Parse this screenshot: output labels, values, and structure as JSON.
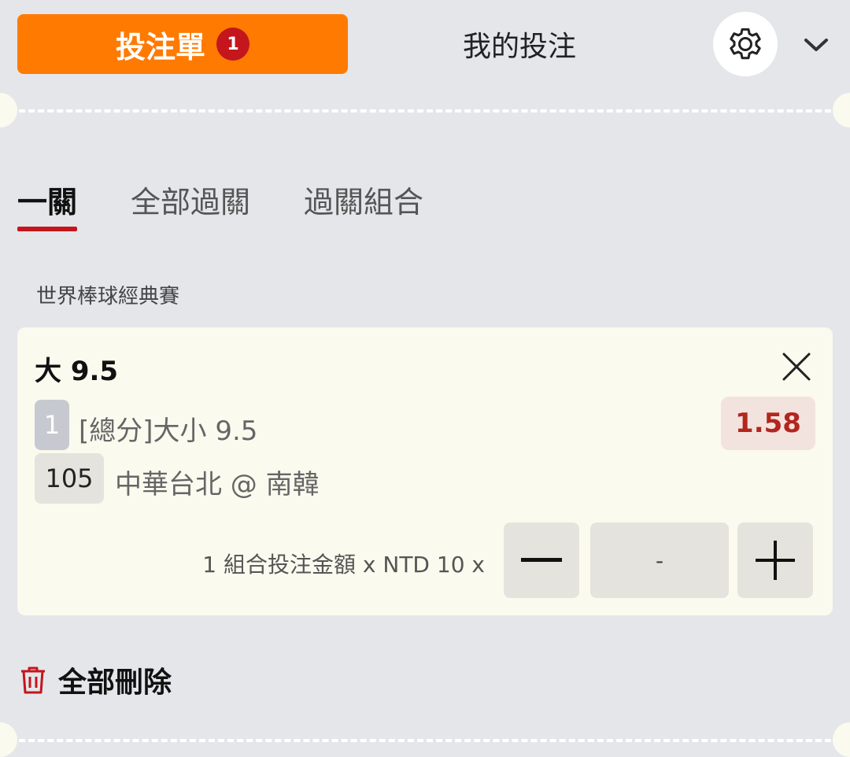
{
  "header": {
    "betslip_label": "投注單",
    "betslip_count": "1",
    "my_bets_label": "我的投注"
  },
  "tabs": [
    {
      "label": "一關",
      "active": true
    },
    {
      "label": "全部過關",
      "active": false
    },
    {
      "label": "過關組合",
      "active": false
    }
  ],
  "league": "世界棒球經典賽",
  "bet": {
    "selection": "大 9.5",
    "leg_number": "1",
    "market": "[總分]大小 9.5",
    "event_code": "105",
    "match": "中華台北 @ 南韓",
    "odds": "1.58",
    "stake_label": "1 組合投注金額 x NTD 10 x",
    "stake_value": "-"
  },
  "footer": {
    "delete_all_label": "全部刪除"
  },
  "colors": {
    "accent": "#ff7a00",
    "badge": "#c4161c",
    "odds_text": "#b3261e",
    "background": "#e4e6ea",
    "card": "#fbfaef"
  }
}
